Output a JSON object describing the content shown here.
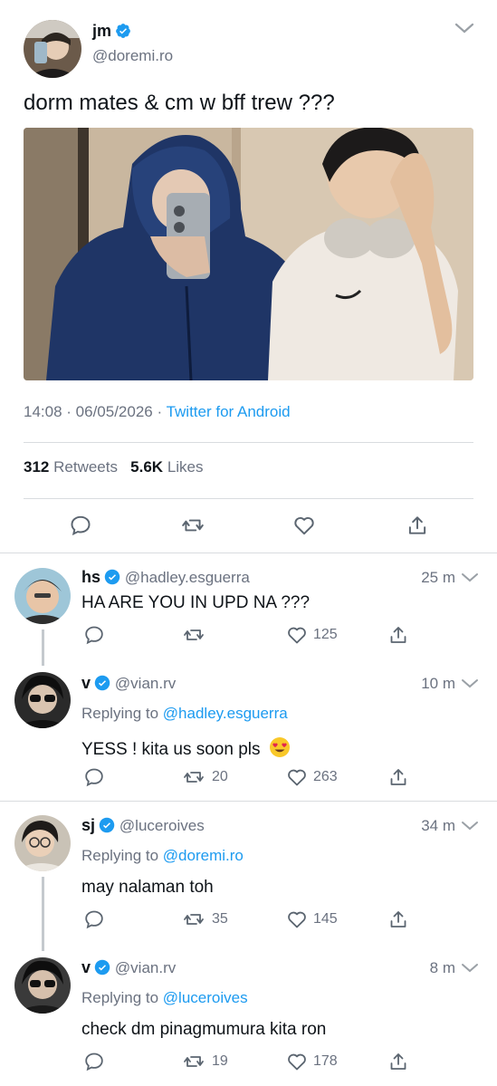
{
  "main_tweet": {
    "display_name": "jm",
    "handle": "@doremi.ro",
    "text": "dorm mates & cm w bff trew ???",
    "time": "14:08",
    "date": "06/05/2026",
    "source": "Twitter for Android",
    "retweets_count": "312",
    "retweets_label": "Retweets",
    "likes_count": "5.6K",
    "likes_label": "Likes"
  },
  "replies": [
    {
      "display_name": "hs",
      "handle": "@hadley.esguerra",
      "time": "25 m",
      "replying_label": "",
      "replying_to": "",
      "text": "HA ARE YOU IN UPD NA ???",
      "retweets": "",
      "likes": "125"
    },
    {
      "display_name": "v",
      "handle": "@vian.rv",
      "time": "10 m",
      "replying_label": "Replying to",
      "replying_to": "@hadley.esguerra",
      "text": "YESS ! kita us soon pls",
      "retweets": "20",
      "likes": "263"
    },
    {
      "display_name": "sj",
      "handle": "@luceroives",
      "time": "34 m",
      "replying_label": "Replying to",
      "replying_to": "@doremi.ro",
      "text": "may nalaman toh",
      "retweets": "35",
      "likes": "145"
    },
    {
      "display_name": "v",
      "handle": "@vian.rv",
      "time": "8 m",
      "replying_label": "Replying to",
      "replying_to": "@luceroives",
      "text": "check dm pinagmumura kita ron",
      "retweets": "19",
      "likes": "178"
    }
  ],
  "colors": {
    "accent": "#1d9bf0",
    "muted": "#6b7280",
    "divider": "#d9dcdf"
  }
}
